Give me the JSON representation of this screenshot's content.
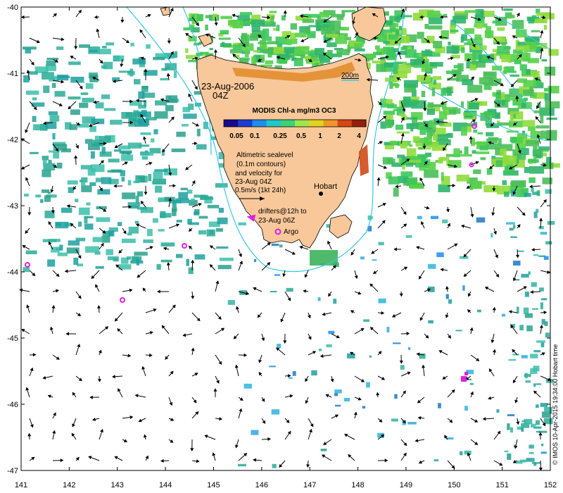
{
  "map": {
    "lon_ticks": [
      "141",
      "142",
      "143",
      "144",
      "145",
      "146",
      "147",
      "148",
      "149",
      "150",
      "151",
      "152"
    ],
    "lat_ticks": [
      "-40",
      "-41",
      "-42",
      "-43",
      "-44",
      "-45",
      "-46",
      "-47"
    ],
    "lon_range": [
      141,
      152
    ],
    "lat_range": [
      -47,
      -40
    ]
  },
  "annotations": {
    "date": "23-Aug-2006",
    "time": "04Z",
    "scale_200m": "200m",
    "altimetric_line1": "Altimetric sealevel",
    "altimetric_line2": "(0.1m contours)",
    "altimetric_line3": "and velocity for",
    "altimetric_line4": "23-Aug 04Z",
    "velocity_scale": "0.5m/s (1kt 24h)",
    "hobart": "Hobart",
    "drifters_line1": "drifters@12h to",
    "drifters_line2": "23-Aug 06Z",
    "argo": "Argo",
    "credit": "© IMOS 10-Apr-2015 19:34:00 Hobart time"
  },
  "colorbar": {
    "title": "MODIS Chl-a mg/m3 OC3",
    "ticks": [
      "0.05",
      "0.1",
      "0.25",
      "0.5",
      "1",
      "2",
      "4"
    ],
    "colors": [
      "#1a0a8c",
      "#1e3cd2",
      "#1f8cf0",
      "#1fc8c8",
      "#3cd27a",
      "#9ee64a",
      "#e6d21e",
      "#f09628",
      "#d74614",
      "#961e0a"
    ]
  },
  "colors": {
    "land": "#f8c89a",
    "contour": "#36c8e6",
    "drifter": "#e020e0",
    "chl_green": "#3cc85a",
    "chl_teal": "#2aaa96"
  }
}
